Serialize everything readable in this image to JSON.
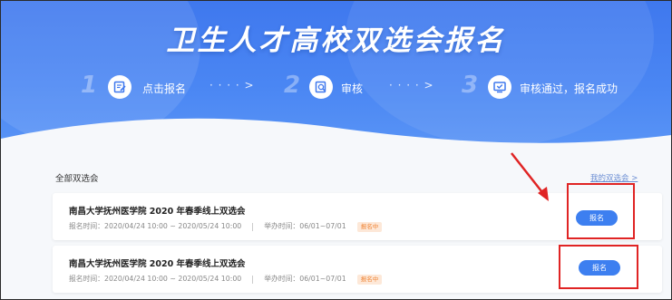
{
  "hero": {
    "title": "卫生人才高校双选会报名",
    "steps": [
      {
        "num": "1",
        "label": "点击报名",
        "icon": "edit-icon"
      },
      {
        "num": "2",
        "label": "审核",
        "icon": "search-doc-icon"
      },
      {
        "num": "3",
        "label": "审核通过，报名成功",
        "icon": "check-screen-icon"
      }
    ],
    "arrow": "· · · · >"
  },
  "main": {
    "section_label": "全部双选会",
    "my_link": "我的双选会 >",
    "fairs": [
      {
        "title": "南昌大学抚州医学院 2020 年春季线上双选会",
        "reg_time": "报名时间：2020/04/24 10:00 ~ 2020/05/24 10:00",
        "hold_time": "举办时间：06/01~07/01",
        "status": "报名中",
        "button": "报名"
      },
      {
        "title": "南昌大学抚州医学院 2020 年春季线上双选会",
        "reg_time": "报名时间：2020/04/24 10:00 ~ 2020/05/24 10:00",
        "hold_time": "举办时间：06/01~07/01",
        "status": "报名中",
        "button": "报名"
      }
    ]
  },
  "colors": {
    "hero_blue": "#4a86f3",
    "button_blue": "#3d7ff0",
    "annotation_red": "#e02424",
    "badge_orange": "#f0873a"
  }
}
